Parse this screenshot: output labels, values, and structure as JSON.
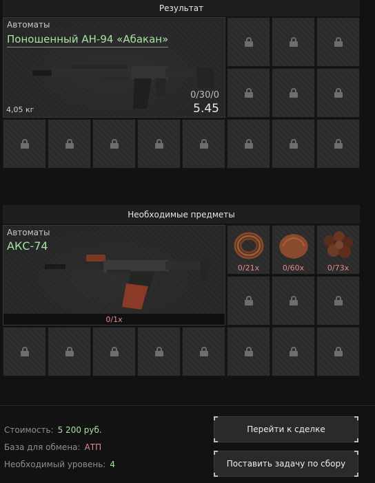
{
  "result_section": {
    "title": "Результат",
    "item": {
      "category": "Автоматы",
      "name": "Поношенный АН-94 «Абакан»",
      "weight": "4,05 кг",
      "ammo": "0/30/0",
      "caliber": "5.45"
    }
  },
  "required_section": {
    "title": "Необходимые предметы",
    "main_item": {
      "category": "Автоматы",
      "name": "АКС-74",
      "count": "0/1x"
    },
    "resources": [
      {
        "name": "copper-wire",
        "count": "0/21x"
      },
      {
        "name": "leather",
        "count": "0/60x"
      },
      {
        "name": "rusty-scrap",
        "count": "0/73x"
      }
    ]
  },
  "footer": {
    "cost_label": "Стоимость:",
    "cost_value": "5 200 руб.",
    "base_label": "База для обмена:",
    "base_value": "АТП",
    "level_label": "Необходимый уровень:",
    "level_value": "4",
    "go_to_deal": "Перейти к сделке",
    "set_task": "Поставить задачу по сбору"
  },
  "colors": {
    "cost_value": "#a6e3a1",
    "base_value": "#e58b8b",
    "level_value": "#a6e3a1"
  }
}
